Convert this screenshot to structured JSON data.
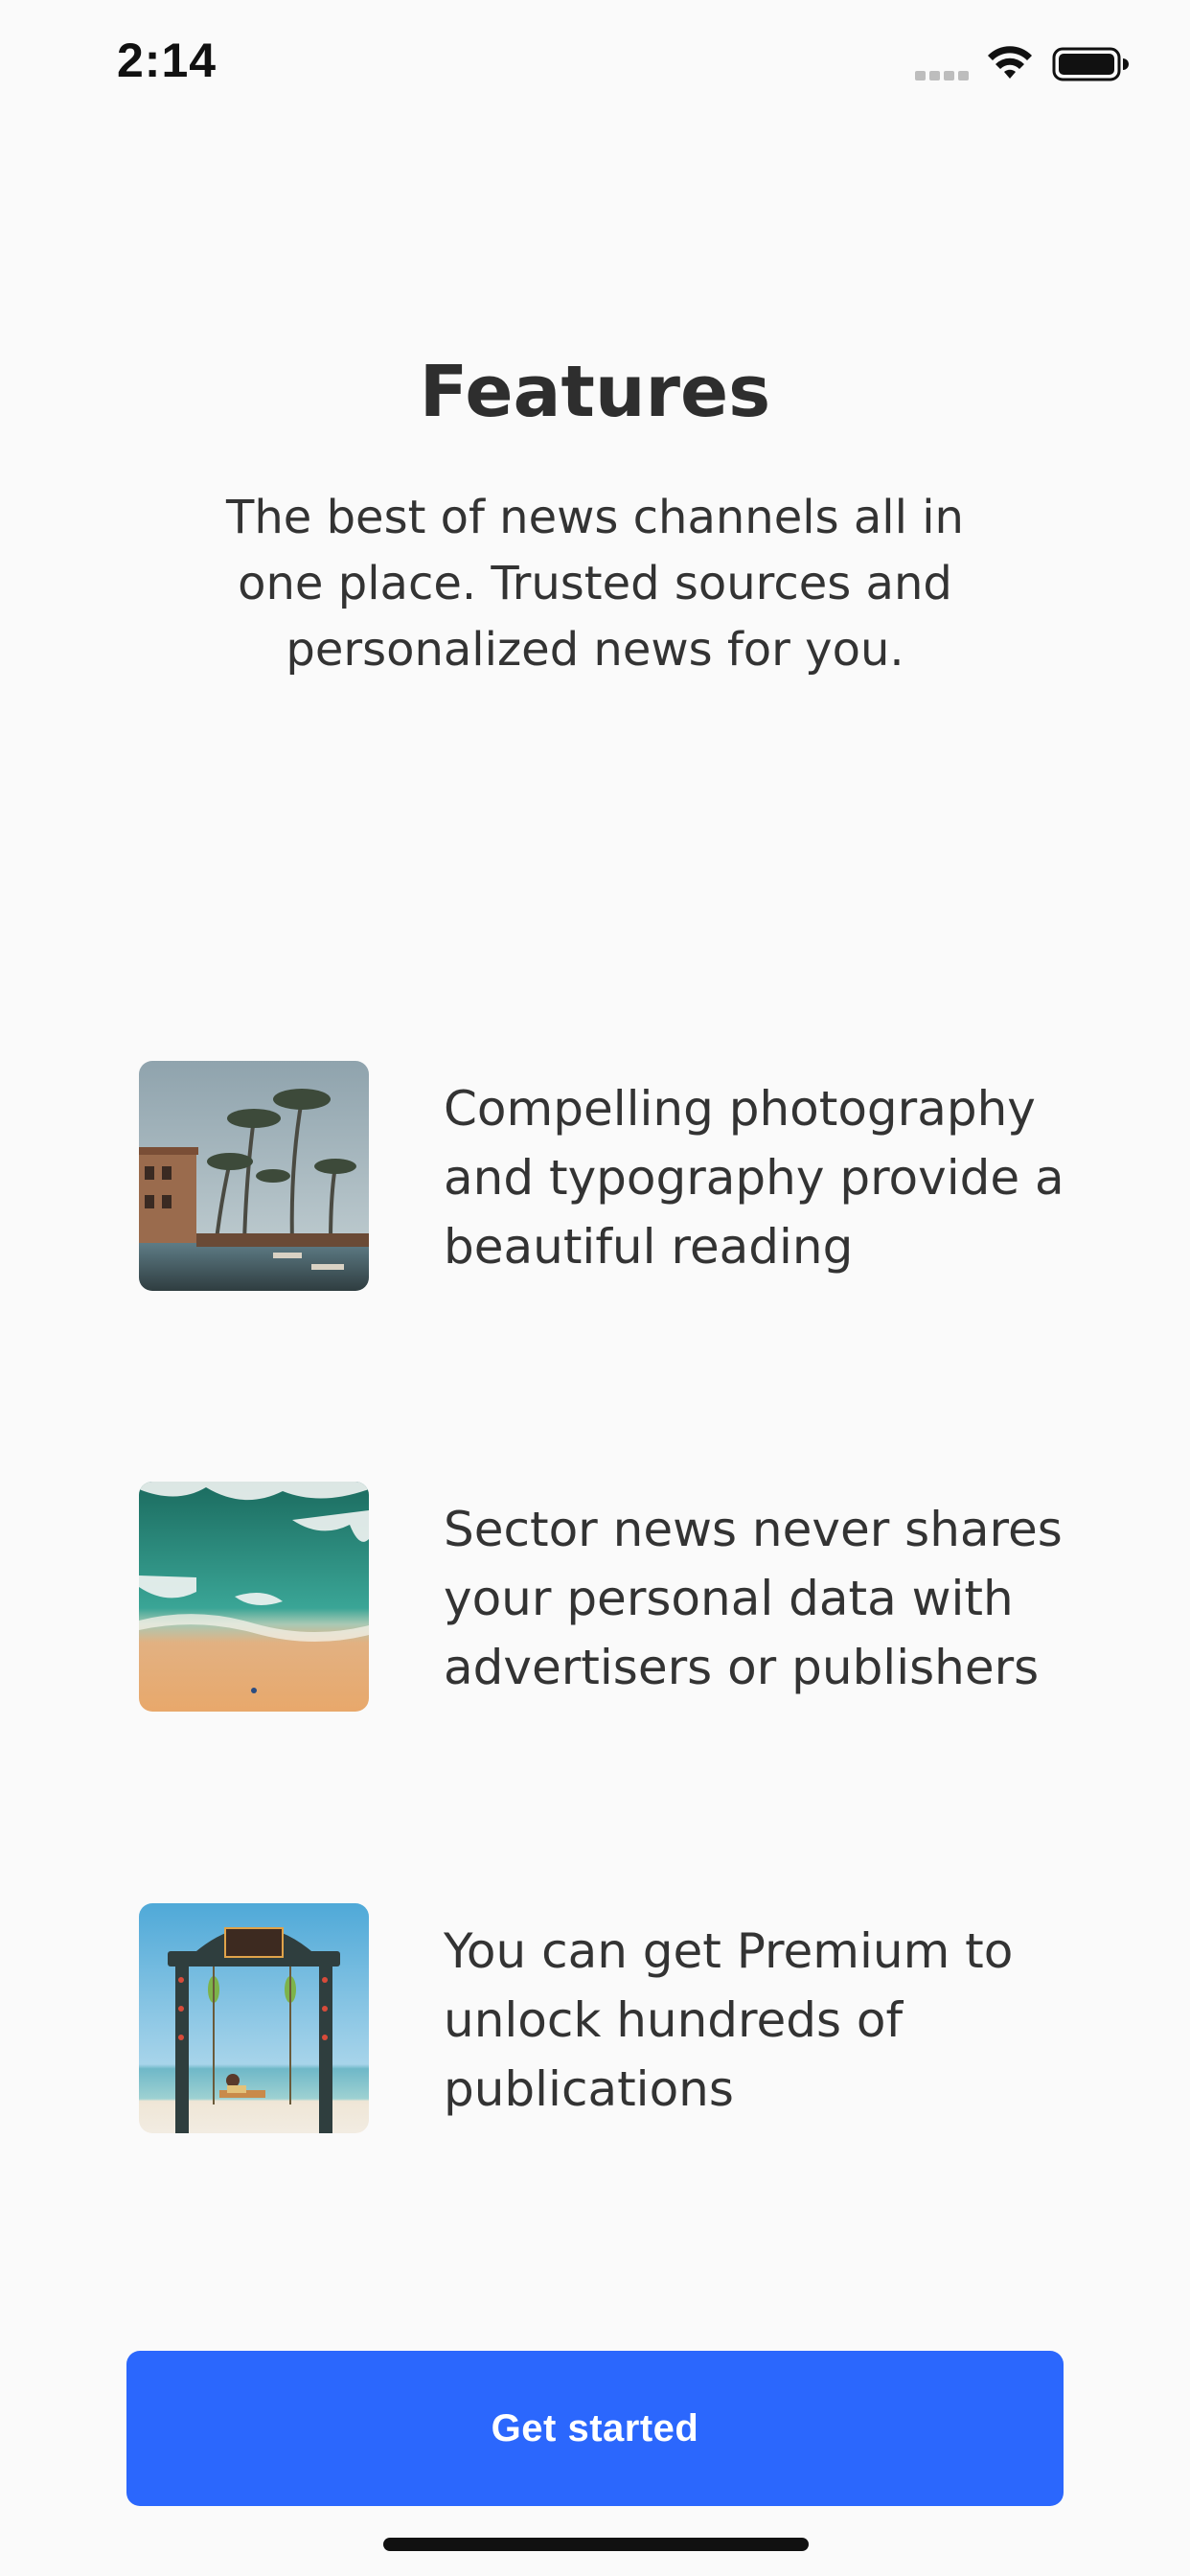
{
  "status_bar": {
    "time": "2:14",
    "icons": [
      "signal-icon",
      "wifi-icon",
      "battery-icon"
    ]
  },
  "header": {
    "title": "Features",
    "subtitle": "The best of news channels all in one place. Trusted sources and personalized news for you."
  },
  "features": [
    {
      "image": "tropical-resort-pool-image",
      "text": "Compelling photography and typography provide a beautiful reading"
    },
    {
      "image": "aerial-beach-waves-image",
      "text": "Sector news never shares your personal data with advertisers or publishers"
    },
    {
      "image": "beach-swing-gate-image",
      "text": "You can get Premium to unlock hundreds of publications"
    }
  ],
  "cta": {
    "label": "Get started"
  },
  "colors": {
    "background": "#fafafa",
    "accent": "#2b67fd",
    "text": "#333333"
  }
}
